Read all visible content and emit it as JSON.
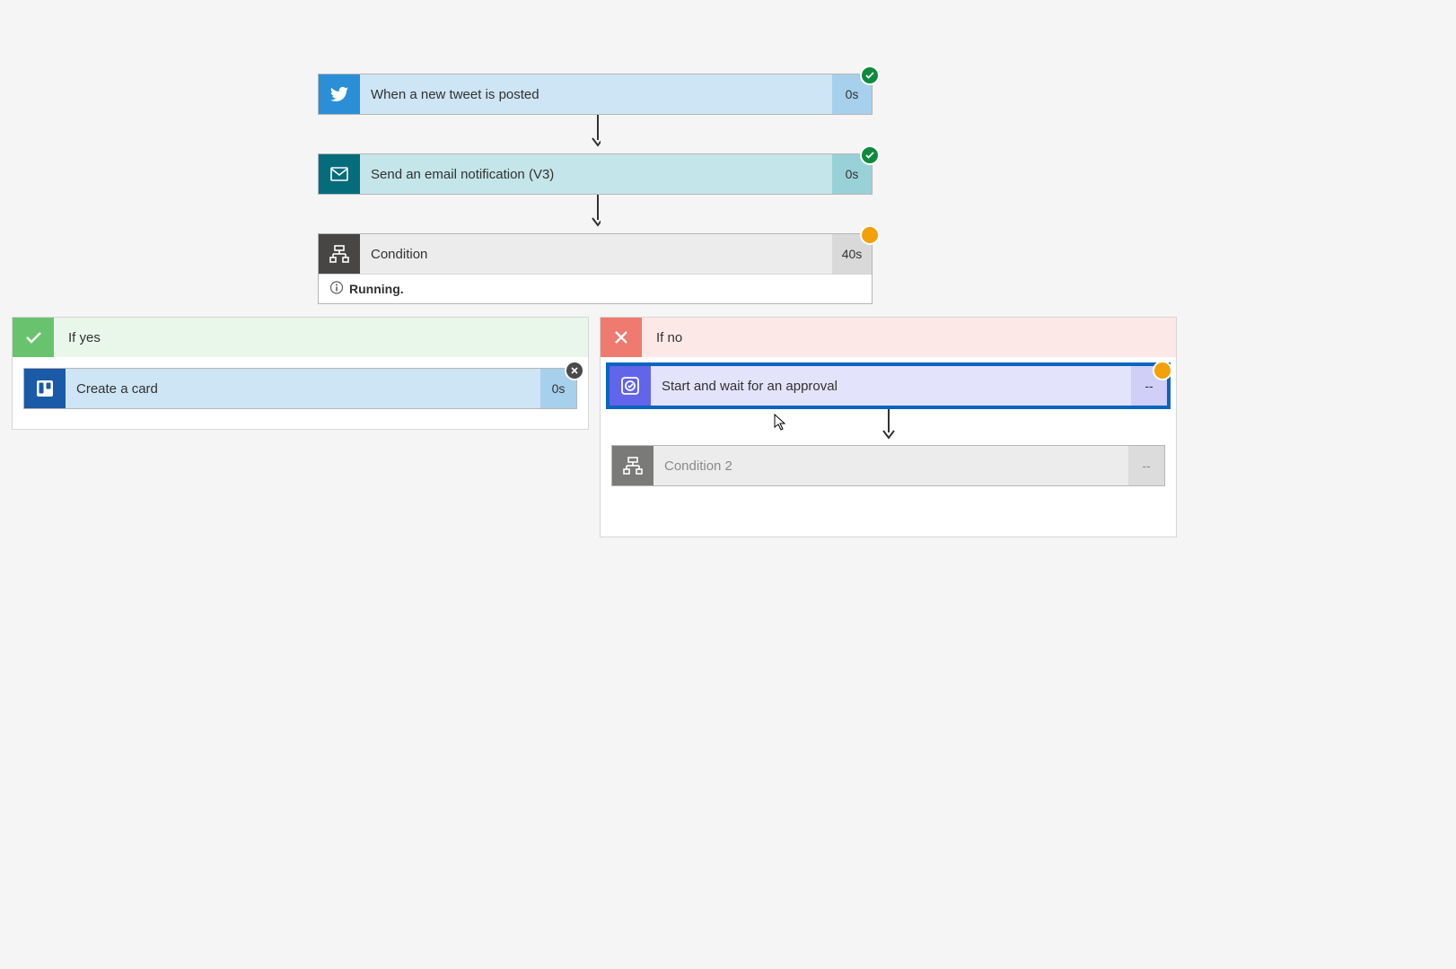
{
  "flow": {
    "trigger": {
      "title": "When a new tweet is posted",
      "duration": "0s",
      "status": "success"
    },
    "email": {
      "title": "Send an email notification (V3)",
      "duration": "0s",
      "status": "success"
    },
    "condition": {
      "title": "Condition",
      "duration": "40s",
      "status": "running",
      "status_text": "Running."
    }
  },
  "branches": {
    "yes": {
      "label": "If yes",
      "steps": [
        {
          "kind": "trello",
          "title": "Create a card",
          "duration": "0s",
          "status": "cancelled"
        }
      ]
    },
    "no": {
      "label": "If no",
      "steps": [
        {
          "kind": "approval",
          "title": "Start and wait for an approval",
          "duration": "--",
          "status": "running",
          "selected": true
        },
        {
          "kind": "condition2",
          "title": "Condition 2",
          "duration": "--",
          "status": "pending"
        }
      ]
    }
  }
}
